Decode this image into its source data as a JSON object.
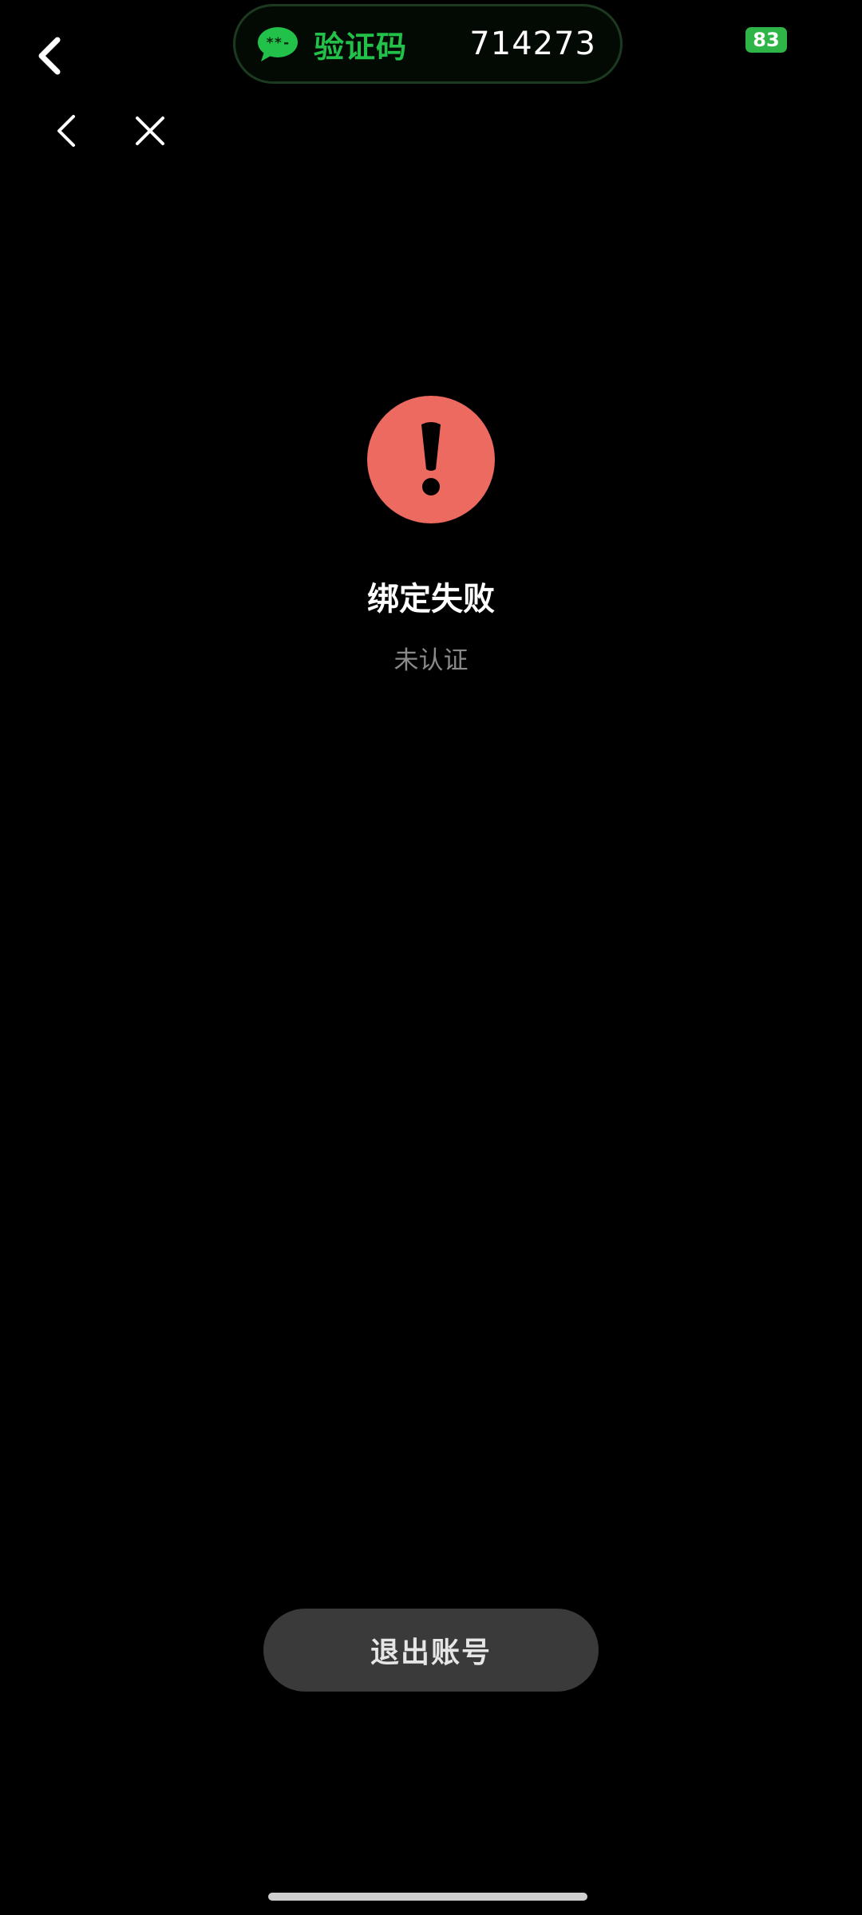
{
  "status_bar": {
    "sms_notification": {
      "label": "验证码",
      "code": "714273",
      "accent_color": "#22c14a",
      "icon": "message-bubble-icon"
    },
    "battery_level": "83",
    "battery_color": "#2fb547"
  },
  "nav": {
    "back_icon": "chevron-left-icon",
    "close_icon": "close-icon"
  },
  "result": {
    "icon": "exclamation-circle-icon",
    "icon_color": "#ec6a5f",
    "title": "绑定失败",
    "subtitle": "未认证"
  },
  "actions": {
    "logout_label": "退出账号"
  }
}
